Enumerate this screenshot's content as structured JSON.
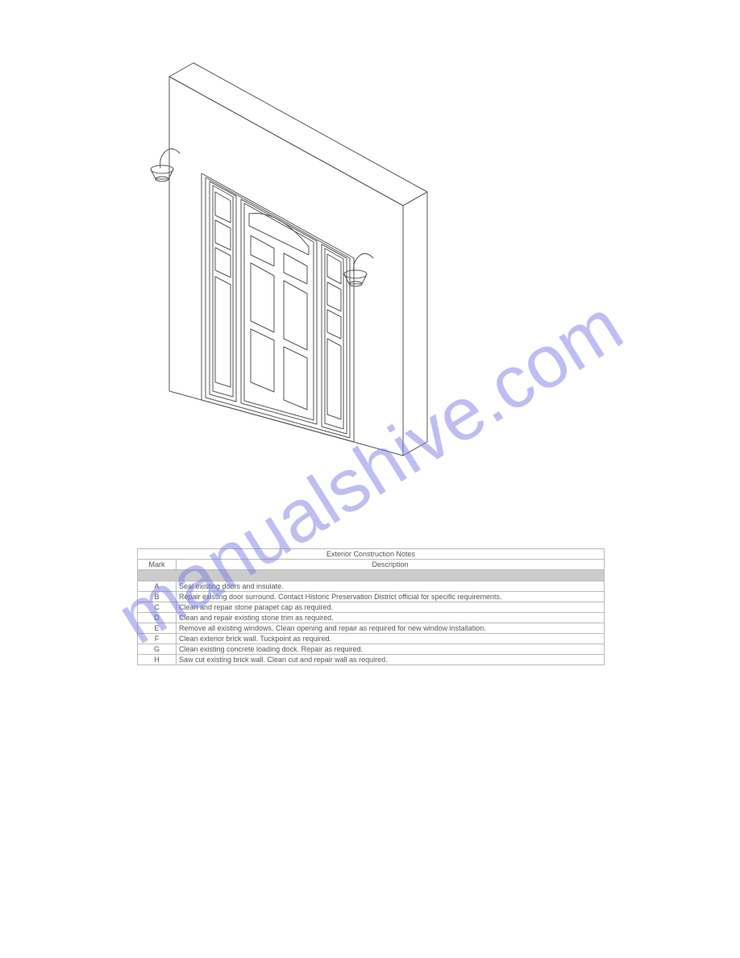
{
  "watermark": "manualshive.com",
  "table": {
    "title": "Exterior Construction Notes",
    "columns": [
      "Mark",
      "Description"
    ],
    "rows": [
      {
        "mark": "A",
        "desc": "Seal existing doors and insulate."
      },
      {
        "mark": "B",
        "desc": "Repair existing door surround. Contact Historic Preservation District official for specific requirements."
      },
      {
        "mark": "C",
        "desc": "Clean and repair stone parapet cap as required."
      },
      {
        "mark": "D",
        "desc": "Clean and repair existing stone trim as required."
      },
      {
        "mark": "E",
        "desc": "Remove all existing windows. Clean opening and repair as required for new window installation."
      },
      {
        "mark": "F",
        "desc": "Clean exterior brick wall. Tuckpoint as required."
      },
      {
        "mark": "G",
        "desc": "Clean existing concrete loading dock. Repair as required."
      },
      {
        "mark": "H",
        "desc": "Saw cut existing brick wall. Clean cut and repair wall as required."
      }
    ]
  }
}
